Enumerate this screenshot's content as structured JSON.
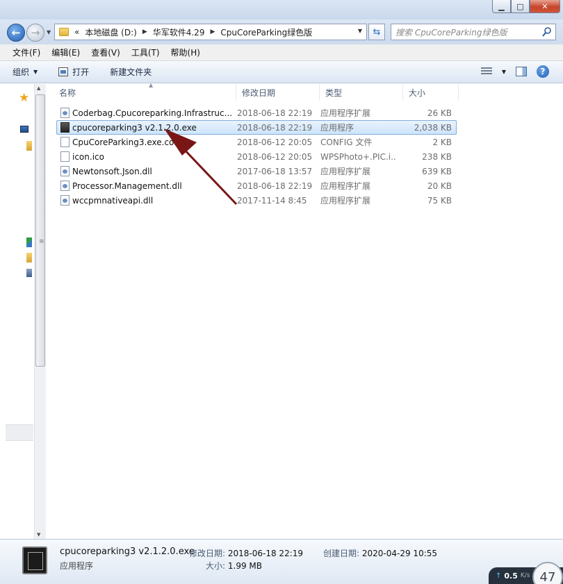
{
  "window": {
    "minimize_glyph": "▁",
    "maximize_glyph": "□",
    "close_glyph": "✕"
  },
  "address": {
    "prefix": "«",
    "crumbs": [
      "本地磁盘 (D:)",
      "华军软件4.29",
      "CpuCoreParking绿色版"
    ],
    "search_placeholder": "搜索 CpuCoreParking绿色版"
  },
  "menu": [
    "文件(F)",
    "编辑(E)",
    "查看(V)",
    "工具(T)",
    "帮助(H)"
  ],
  "toolbar": {
    "organize": "组织",
    "open": "打开",
    "new_folder": "新建文件夹"
  },
  "columns": {
    "name": "名称",
    "date": "修改日期",
    "type": "类型",
    "size": "大小"
  },
  "files": [
    {
      "name": "Coderbag.Cpucoreparking.Infrastruc...",
      "date": "2018-06-18 22:19",
      "type": "应用程序扩展",
      "size": "26 KB",
      "icon": "dll-icon"
    },
    {
      "name": "cpucoreparking3 v2.1.2.0.exe",
      "date": "2018-06-18 22:19",
      "type": "应用程序",
      "size": "2,038 KB",
      "icon": "exe-icon",
      "selected": true
    },
    {
      "name": "CpuCoreParking3.exe.config",
      "date": "2018-06-12 20:05",
      "type": "CONFIG 文件",
      "size": "2 KB",
      "icon": "file-icon"
    },
    {
      "name": "icon.ico",
      "date": "2018-06-12 20:05",
      "type": "WPSPhoto+.PIC.i...",
      "size": "238 KB",
      "icon": "file-icon"
    },
    {
      "name": "Newtonsoft.Json.dll",
      "date": "2017-06-18 13:57",
      "type": "应用程序扩展",
      "size": "639 KB",
      "icon": "dll-icon"
    },
    {
      "name": "Processor.Management.dll",
      "date": "2018-06-18 22:19",
      "type": "应用程序扩展",
      "size": "20 KB",
      "icon": "dll-icon"
    },
    {
      "name": "wccpmnativeapi.dll",
      "date": "2017-11-14 8:45",
      "type": "应用程序扩展",
      "size": "75 KB",
      "icon": "dll-icon"
    }
  ],
  "details": {
    "name": "cpucoreparking3 v2.1.2.0.exe",
    "kind": "应用程序",
    "modified_label": "修改日期:",
    "modified": "2018-06-18 22:19",
    "size_label": "大小:",
    "size": "1.99 MB",
    "created_label": "创建日期:",
    "created": "2020-04-29 10:55"
  },
  "network": {
    "rate": "0.5",
    "unit": "K/s",
    "percent": "47"
  },
  "colors": {
    "selection": "#cde4fb",
    "annotation_arrow": "#7a1616"
  }
}
